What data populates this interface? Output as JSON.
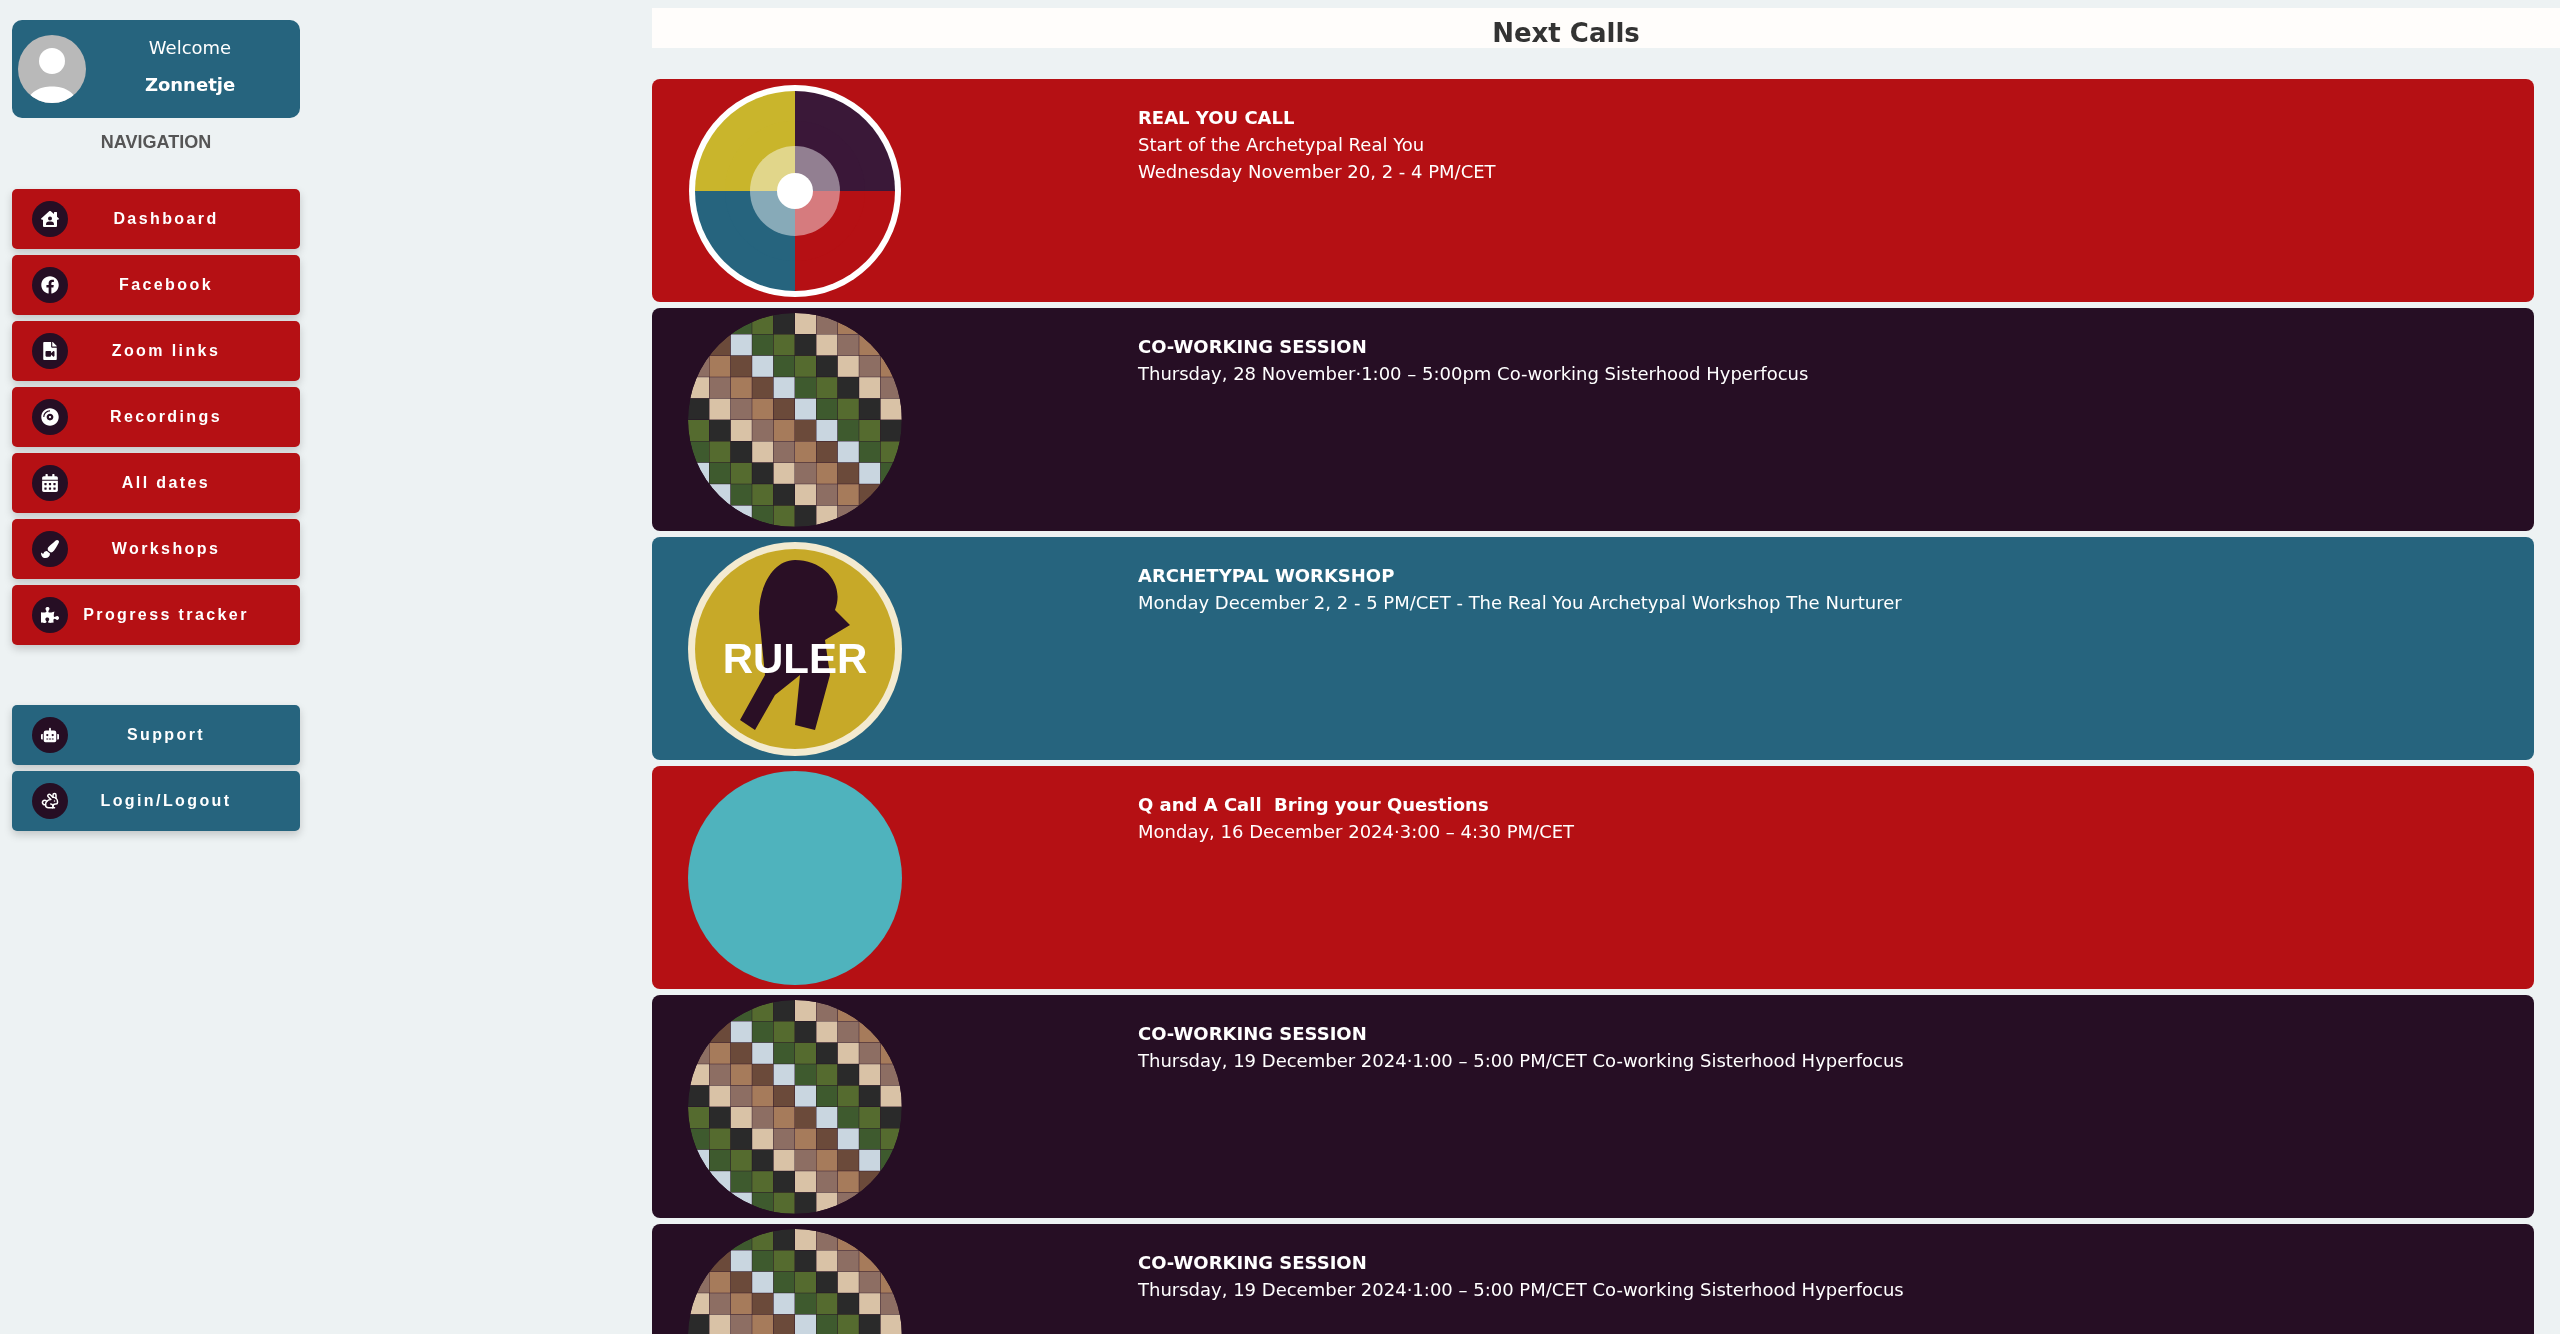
{
  "profile": {
    "greeting": "Welcome",
    "name": "Zonnetje"
  },
  "navigation": {
    "title": "NAVIGATION",
    "items": [
      {
        "label": "Dashboard",
        "color": "#b51014"
      },
      {
        "label": "Facebook",
        "color": "#b51014"
      },
      {
        "label": "Zoom links",
        "color": "#b51014"
      },
      {
        "label": "Recordings",
        "color": "#b51014"
      },
      {
        "label": "All dates",
        "color": "#b51014"
      },
      {
        "label": "Workshops",
        "color": "#b51014"
      },
      {
        "label": "Progress tracker",
        "color": "#b51014"
      }
    ],
    "secondary_items": [
      {
        "label": "Support",
        "color": "#26647e"
      },
      {
        "label": "Login/Logout",
        "color": "#26647e"
      }
    ]
  },
  "main": {
    "title": "Next Calls",
    "calls": [
      {
        "kind": "wheel",
        "color": "#b51014",
        "title": "REAL YOU CALL",
        "lines": [
          "Start of the Archetypal Real You",
          "Wednesday November 20, 2 - 4 PM/CET"
        ]
      },
      {
        "kind": "collage",
        "color": "#260e24",
        "title": "CO-WORKING SESSION",
        "lines": [
          "Thursday, 28 November·1:00 – 5:00pm Co-working Sisterhood Hyperfocus"
        ]
      },
      {
        "kind": "emblem",
        "color": "#26647e",
        "emblem_text": "RULER",
        "title": "ARCHETYPAL WORKSHOP",
        "lines": [
          "Monday December 2, 2 - 5 PM/CET - The Real You Archetypal Workshop The Nurturer"
        ]
      },
      {
        "kind": "portrait",
        "color": "#b51014",
        "title": "Q and A Call  Bring your Questions",
        "lines": [
          "Monday, 16 December 2024·3:00 – 4:30 PM/CET"
        ]
      },
      {
        "kind": "collage",
        "color": "#260e24",
        "title": "CO-WORKING SESSION",
        "lines": [
          "Thursday, 19 December 2024·1:00 – 5:00 PM/CET Co-working Sisterhood Hyperfocus"
        ]
      },
      {
        "kind": "collage",
        "color": "#260e24",
        "title": "CO-WORKING SESSION",
        "lines": [
          "Thursday, 19 December 2024·1:00 – 5:00 PM/CET Co-working Sisterhood Hyperfocus"
        ]
      }
    ]
  }
}
